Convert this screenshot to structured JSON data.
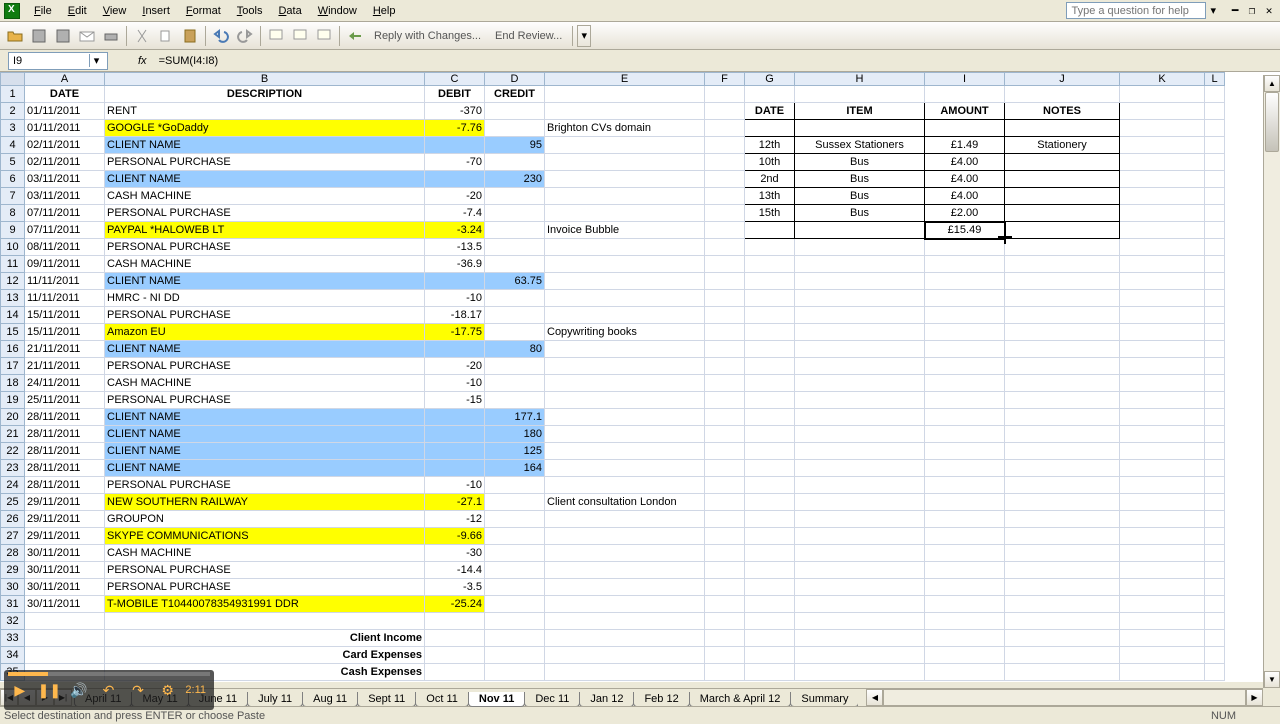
{
  "menu": {
    "items": [
      "File",
      "Edit",
      "View",
      "Insert",
      "Format",
      "Tools",
      "Data",
      "Window",
      "Help"
    ],
    "help_placeholder": "Type a question for help"
  },
  "toolbar": {
    "reply": "Reply with Changes...",
    "end_review": "End Review..."
  },
  "formula": {
    "cell_ref": "I9",
    "formula_text": "=SUM(I4:I8)"
  },
  "columns": {
    "letters": [
      "",
      "A",
      "B",
      "C",
      "D",
      "E",
      "F",
      "G",
      "H",
      "I",
      "J",
      "K",
      "L"
    ],
    "widths": [
      24,
      80,
      320,
      60,
      60,
      160,
      40,
      50,
      130,
      80,
      115,
      85,
      20
    ],
    "headers": [
      "DATE",
      "DESCRIPTION",
      "DEBIT",
      "CREDIT"
    ]
  },
  "rows": [
    {
      "n": 1,
      "hdr": true,
      "A": "DATE",
      "B": "DESCRIPTION",
      "C": "DEBIT",
      "D": "CREDIT"
    },
    {
      "n": 2,
      "A": "01/11/2011",
      "B": "RENT",
      "C": "-370"
    },
    {
      "n": 3,
      "A": "01/11/2011",
      "B": "GOOGLE *GoDaddy",
      "C": "-7.76",
      "E": "Brighton CVs domain",
      "hlB": "yellow",
      "hlC": "yellow"
    },
    {
      "n": 4,
      "A": "02/11/2011",
      "B": "CLIENT NAME",
      "D": "95",
      "hlB": "blue",
      "hlC": "blue",
      "hlD": "blue"
    },
    {
      "n": 5,
      "A": "02/11/2011",
      "B": "PERSONAL PURCHASE",
      "C": "-70"
    },
    {
      "n": 6,
      "A": "03/11/2011",
      "B": "CLIENT NAME",
      "D": "230",
      "hlB": "blue",
      "hlC": "blue",
      "hlD": "blue"
    },
    {
      "n": 7,
      "A": "03/11/2011",
      "B": "CASH MACHINE",
      "C": "-20"
    },
    {
      "n": 8,
      "A": "07/11/2011",
      "B": "PERSONAL PURCHASE",
      "C": "-7.4"
    },
    {
      "n": 9,
      "A": "07/11/2011",
      "B": "PAYPAL *HALOWEB LT",
      "C": "-3.24",
      "E": "Invoice Bubble",
      "hlB": "yellow",
      "hlC": "yellow"
    },
    {
      "n": 10,
      "A": "08/11/2011",
      "B": "PERSONAL PURCHASE",
      "C": "-13.5"
    },
    {
      "n": 11,
      "A": "09/11/2011",
      "B": "CASH MACHINE",
      "C": "-36.9"
    },
    {
      "n": 12,
      "A": "11/11/2011",
      "B": "CLIENT NAME",
      "D": "63.75",
      "hlB": "blue",
      "hlC": "blue",
      "hlD": "blue"
    },
    {
      "n": 13,
      "A": "11/11/2011",
      "B": "HMRC - NI DD",
      "C": "-10"
    },
    {
      "n": 14,
      "A": "15/11/2011",
      "B": "PERSONAL PURCHASE",
      "C": "-18.17"
    },
    {
      "n": 15,
      "A": "15/11/2011",
      "B": "Amazon EU",
      "C": "-17.75",
      "E": "Copywriting books",
      "hlB": "yellow",
      "hlC": "yellow"
    },
    {
      "n": 16,
      "A": "21/11/2011",
      "B": "CLIENT NAME",
      "D": "80",
      "hlB": "blue",
      "hlC": "blue",
      "hlD": "blue"
    },
    {
      "n": 17,
      "A": "21/11/2011",
      "B": "PERSONAL PURCHASE",
      "C": "-20"
    },
    {
      "n": 18,
      "A": "24/11/2011",
      "B": "CASH MACHINE",
      "C": "-10"
    },
    {
      "n": 19,
      "A": "25/11/2011",
      "B": "PERSONAL PURCHASE",
      "C": "-15"
    },
    {
      "n": 20,
      "A": "28/11/2011",
      "B": "CLIENT NAME",
      "D": "177.1",
      "hlB": "blue",
      "hlC": "blue",
      "hlD": "blue"
    },
    {
      "n": 21,
      "A": "28/11/2011",
      "B": "CLIENT NAME",
      "D": "180",
      "hlB": "blue",
      "hlC": "blue",
      "hlD": "blue"
    },
    {
      "n": 22,
      "A": "28/11/2011",
      "B": "CLIENT NAME",
      "D": "125",
      "hlB": "blue",
      "hlC": "blue",
      "hlD": "blue"
    },
    {
      "n": 23,
      "A": "28/11/2011",
      "B": "CLIENT NAME",
      "D": "164",
      "hlB": "blue",
      "hlC": "blue",
      "hlD": "blue"
    },
    {
      "n": 24,
      "A": "28/11/2011",
      "B": "PERSONAL PURCHASE",
      "C": "-10"
    },
    {
      "n": 25,
      "A": "29/11/2011",
      "B": "NEW SOUTHERN RAILWAY",
      "C": "-27.1",
      "E": "Client consultation London",
      "hlB": "yellow",
      "hlC": "yellow"
    },
    {
      "n": 26,
      "A": "29/11/2011",
      "B": "GROUPON",
      "C": "-12"
    },
    {
      "n": 27,
      "A": "29/11/2011",
      "B": "SKYPE COMMUNICATIONS",
      "C": "-9.66",
      "hlB": "yellow",
      "hlC": "yellow"
    },
    {
      "n": 28,
      "A": "30/11/2011",
      "B": "CASH MACHINE",
      "C": "-30"
    },
    {
      "n": 29,
      "A": "30/11/2011",
      "B": "PERSONAL PURCHASE",
      "C": "-14.4"
    },
    {
      "n": 30,
      "A": "30/11/2011",
      "B": "PERSONAL PURCHASE",
      "C": "-3.5"
    },
    {
      "n": 31,
      "A": "30/11/2011",
      "B": "T-MOBILE          T10440078354931991 DDR",
      "C": "-25.24",
      "hlB": "yellow",
      "hlC": "yellow"
    },
    {
      "n": 32
    },
    {
      "n": 33,
      "B": "Client Income",
      "bold": true,
      "align": "right"
    },
    {
      "n": 34,
      "B": "Card Expenses",
      "bold": true,
      "align": "right"
    },
    {
      "n": 35,
      "B": "Cash Expenses",
      "bold": true,
      "align": "right"
    }
  ],
  "side_table": {
    "headers": [
      "DATE",
      "ITEM",
      "AMOUNT",
      "NOTES"
    ],
    "rows": [
      {
        "date": "",
        "item": "",
        "amount": "",
        "notes": ""
      },
      {
        "date": "12th",
        "item": "Sussex Stationers",
        "amount": "£1.49",
        "notes": "Stationery"
      },
      {
        "date": "10th",
        "item": "Bus",
        "amount": "£4.00",
        "notes": ""
      },
      {
        "date": "2nd",
        "item": "Bus",
        "amount": "£4.00",
        "notes": ""
      },
      {
        "date": "13th",
        "item": "Bus",
        "amount": "£4.00",
        "notes": ""
      },
      {
        "date": "15th",
        "item": "Bus",
        "amount": "£2.00",
        "notes": ""
      }
    ],
    "sum": "£15.49"
  },
  "tabs": {
    "items": [
      "April 11",
      "May 11",
      "June 11",
      "July 11",
      "Aug 11",
      "Sept 11",
      "Oct 11",
      "Nov 11",
      "Dec 11",
      "Jan 12",
      "Feb 12",
      "March & April 12",
      "Summary"
    ],
    "active": "Nov 11"
  },
  "status": {
    "left": "Select destination and press ENTER or choose Paste",
    "right": "NUM"
  },
  "media": {
    "time": "2:11"
  }
}
